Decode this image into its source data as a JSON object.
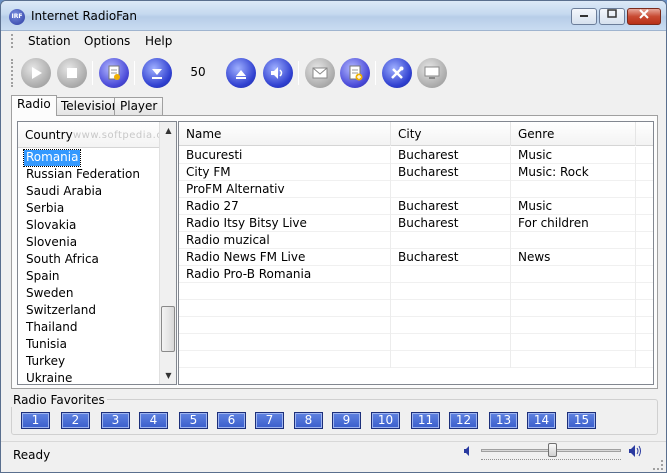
{
  "window": {
    "title": "Internet RadioFan",
    "app_icon_text": "IRF"
  },
  "menu": {
    "items": [
      "Station",
      "Options",
      "Help"
    ]
  },
  "toolbar": {
    "buttons": [
      {
        "name": "play-button",
        "icon": "play-icon"
      },
      {
        "name": "stop-button",
        "icon": "stop-icon"
      },
      {
        "name": "record-button",
        "icon": "record-doc-icon"
      },
      {
        "name": "volume-down-button",
        "icon": "volume-down-icon"
      },
      {
        "name": "volume-up-button",
        "icon": "volume-up-icon"
      },
      {
        "name": "mute-button",
        "icon": "speaker-icon"
      },
      {
        "name": "email-button",
        "icon": "envelope-icon"
      },
      {
        "name": "add-station-button",
        "icon": "add-doc-icon"
      },
      {
        "name": "settings-button",
        "icon": "tools-icon"
      },
      {
        "name": "screen-button",
        "icon": "monitor-icon"
      }
    ],
    "volume_value": "50"
  },
  "tabs": [
    "Radio",
    "Television",
    "Player"
  ],
  "country_list": {
    "header": "Country",
    "watermark": "www.softpedia.com",
    "items": [
      "Romania",
      "Russian Federation",
      "Saudi Arabia",
      "Serbia",
      "Slovakia",
      "Slovenia",
      "South Africa",
      "Spain",
      "Sweden",
      "Switzerland",
      "Thailand",
      "Tunisia",
      "Turkey",
      "Ukraine"
    ],
    "selected": "Romania"
  },
  "station_table": {
    "columns": [
      "Name",
      "City",
      "Genre"
    ],
    "rows": [
      [
        "Bucuresti",
        "Bucharest",
        "Music"
      ],
      [
        "City FM",
        "Bucharest",
        "Music: Rock"
      ],
      [
        "ProFM Alternativ",
        "",
        ""
      ],
      [
        "Radio 27",
        "Bucharest",
        "Music"
      ],
      [
        "Radio Itsy Bitsy Live",
        "Bucharest",
        "For children"
      ],
      [
        "Radio muzical",
        "",
        ""
      ],
      [
        "Radio News FM Live",
        "Bucharest",
        "News"
      ],
      [
        "Radio Pro-B Romania",
        "",
        ""
      ]
    ]
  },
  "favorites": {
    "label": "Radio Favorites",
    "buttons": [
      "1",
      "2",
      "3",
      "4",
      "5",
      "6",
      "7",
      "8",
      "9",
      "10",
      "11",
      "12",
      "13",
      "14",
      "15"
    ]
  },
  "status": {
    "text": "Ready",
    "volume_level": 0.5
  },
  "colors": {
    "accent": "#3399ff",
    "favorites_button": "#3a5ecc",
    "toolbar_blue": "#3040d0"
  }
}
